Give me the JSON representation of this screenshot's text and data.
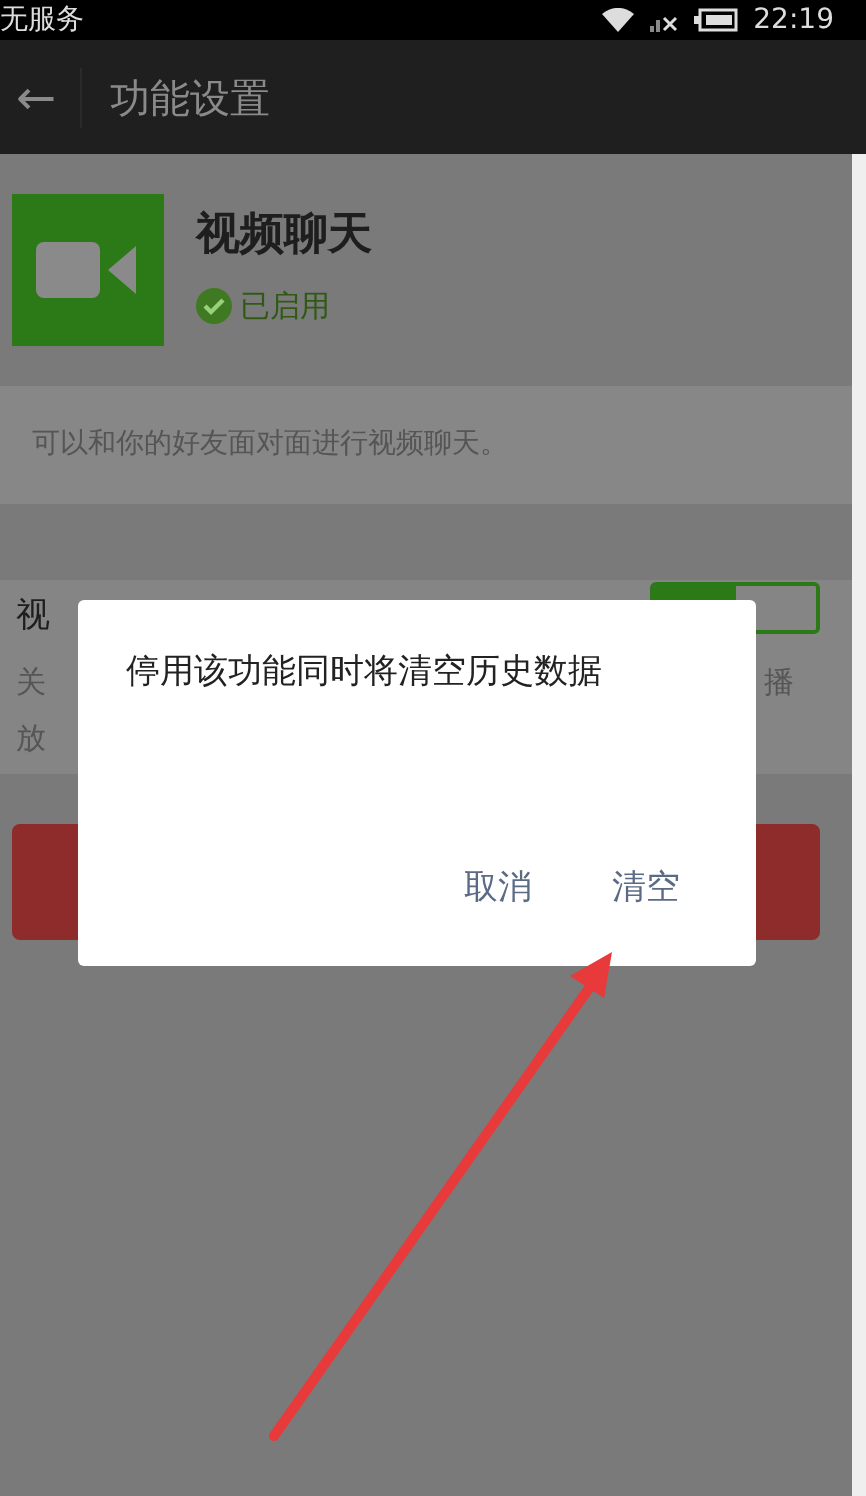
{
  "status_bar": {
    "carrier": "无服务",
    "time": "22:19"
  },
  "header": {
    "back": "←",
    "title": "功能设置"
  },
  "feature": {
    "name": "视频聊天",
    "status": "已启用",
    "enabled": true
  },
  "description": "可以和你的好友面对面进行视频聊天。",
  "setting": {
    "label": "视",
    "fragments": [
      "关",
      "播",
      "放"
    ],
    "on": true
  },
  "dialog": {
    "message": "停用该功能同时将清空历史数据",
    "buttons": [
      "取消",
      "清空"
    ]
  }
}
